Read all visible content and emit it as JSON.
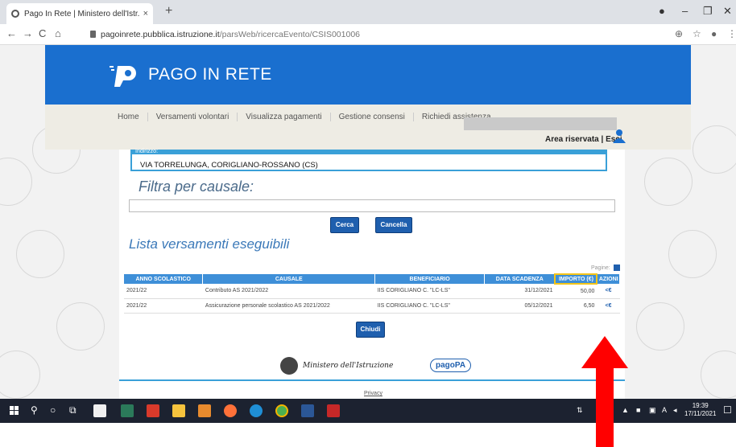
{
  "browser": {
    "tab_title": "Pago In Rete | Ministero dell'Istr...",
    "tab_close": "×",
    "new_tab": "+",
    "url_host": "pagoinrete.pubblica.istruzione.it",
    "url_path": "/parsWeb/ricercaEvento/CSIS001006"
  },
  "site": {
    "logo_text": "PAGO IN RETE",
    "menu": [
      "Home",
      "Versamenti volontari",
      "Visualizza pagamenti",
      "Gestione consensi",
      "Richiedi assistenza"
    ],
    "area_riservata": "Area riservata | Esci"
  },
  "main": {
    "indirizzo_label": "Indirizzo:",
    "indirizzo_value": "VIA TORRELUNGA, CORIGLIANO-ROSSANO (CS)",
    "filter_heading": "Filtra per causale:",
    "btn_cerca": "Cerca",
    "btn_cancella": "Cancella",
    "lista_heading": "Lista versamenti eseguibili",
    "pagine": "Pagine:",
    "btn_chiudi": "Chiudi",
    "ministero": "Ministero dell'Istruzione",
    "pagopa": "pagoPA",
    "privacy": "Privacy"
  },
  "table": {
    "headers": [
      "ANNO SCOLASTICO",
      "CAUSALE",
      "BENEFICIARIO",
      "DATA SCADENZA",
      "IMPORTO (€)",
      "AZIONI"
    ],
    "rows": [
      {
        "anno": "2021/22",
        "causale": "Contributo AS 2021/2022",
        "beneficiario": "IIS CORIGLIANO C. \"LC-LS\"",
        "scadenza": "31/12/2021",
        "importo": "50,00",
        "azione": "<€"
      },
      {
        "anno": "2021/22",
        "causale": "Assicurazione personale scolastico AS 2021/2022",
        "beneficiario": "IIS CORIGLIANO C. \"LC-LS\"",
        "scadenza": "05/12/2021",
        "importo": "6,50",
        "azione": "<€"
      }
    ]
  },
  "taskbar": {
    "time": "19:39",
    "date": "17/11/2021"
  },
  "colors": {
    "header_blue": "#1a6fcf",
    "table_header": "#3e8fd8",
    "button_blue": "#1f5fae",
    "arrow_red": "#ff0000"
  }
}
